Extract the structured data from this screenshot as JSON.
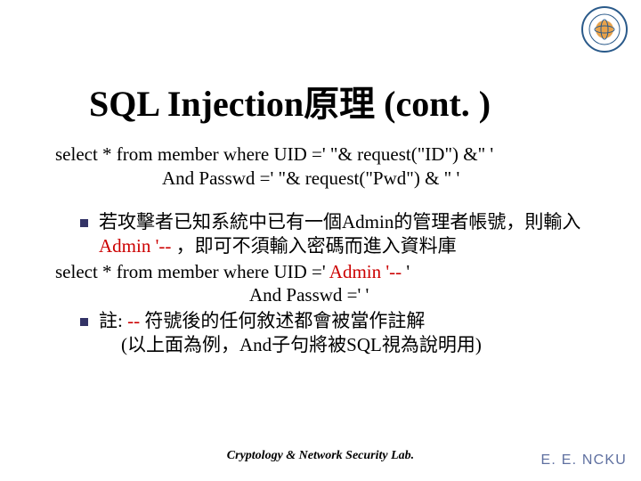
{
  "title": "SQL Injection原理 (cont. )",
  "sql_example1": {
    "line1": "select * from member where UID ='  \"& request(\"ID\") &\"  '",
    "line2": "And Passwd =' \"& request(\"Pwd\") & \" '"
  },
  "bullet1": {
    "pre": "若攻擊者已知系統中已有一個Admin的管理者帳號，則輸入",
    "highlight": "Admin '--",
    "post": " ，即可不須輸入密碼而進入資料庫"
  },
  "sql_example2": {
    "line1_pre": "select * from member where UID ='",
    "line1_hi": " Admin '-- ",
    "line1_post": "'",
    "line2": "And Passwd =' '"
  },
  "bullet2": {
    "line1_pre": "註: ",
    "line1_hi": "--",
    "line1_post": " 符號後的任何敘述都會被當作註解",
    "line2": "(以上面為例，And子句將被SQL視為說明用)"
  },
  "footer_center": "Cryptology & Network Security Lab.",
  "footer_right": "E. E. NCKU",
  "logo_name": "department-seal"
}
